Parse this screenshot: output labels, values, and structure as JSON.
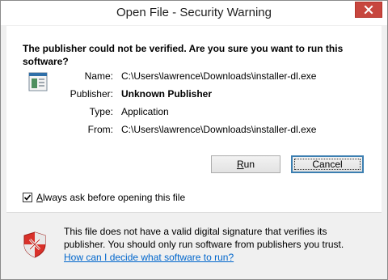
{
  "window": {
    "title": "Open File - Security Warning"
  },
  "headline": "The publisher could not be verified.  Are you sure you want to run this software?",
  "details": [
    {
      "label": "Name:",
      "value": "C:\\Users\\lawrence\\Downloads\\installer-dl.exe",
      "bold": false
    },
    {
      "label": "Publisher:",
      "value": "Unknown Publisher",
      "bold": true
    },
    {
      "label": "Type:",
      "value": "Application",
      "bold": false
    },
    {
      "label": "From:",
      "value": "C:\\Users\\lawrence\\Downloads\\installer-dl.exe",
      "bold": false
    }
  ],
  "buttons": {
    "run": {
      "underlined": "R",
      "rest": "un"
    },
    "cancel": "Cancel"
  },
  "checkbox": {
    "checked": true,
    "underlined": "A",
    "rest": "lways ask before opening this file"
  },
  "warning": {
    "line1": "This file does not have a valid digital signature that verifies its",
    "line2": "publisher.  You should only run software from publishers you trust.",
    "link": "How can I decide what software to run?"
  },
  "colors": {
    "close": "#c7463e",
    "link": "#0066cc",
    "shield": "#d9312a"
  },
  "icons": {
    "close": "close-icon",
    "file": "application-file-icon",
    "shield": "shield-error-icon",
    "check": "checkmark-icon"
  }
}
